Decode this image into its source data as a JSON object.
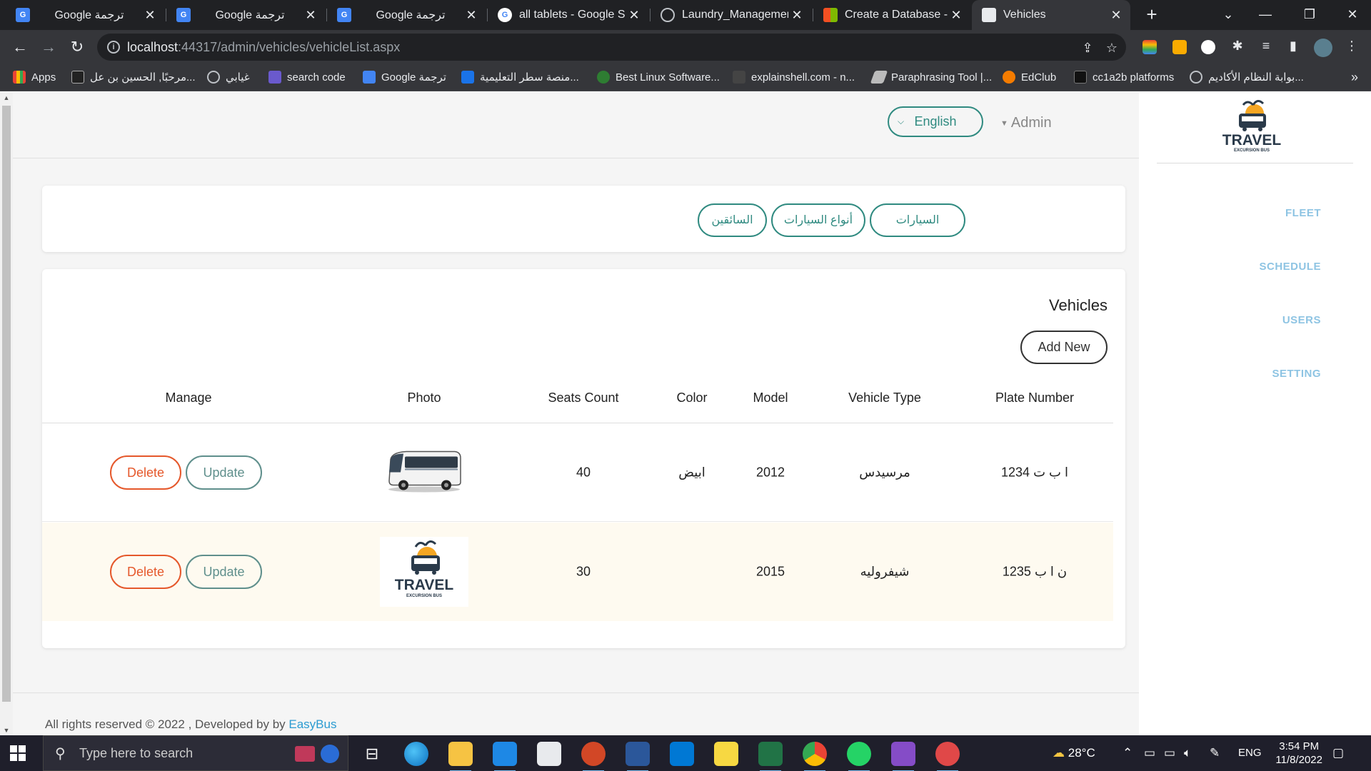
{
  "browser": {
    "tabs": [
      {
        "title": "Google ترجمة",
        "icon": "google-translate-icon",
        "active": false
      },
      {
        "title": "Google ترجمة",
        "icon": "google-translate-icon",
        "active": false
      },
      {
        "title": "Google ترجمة",
        "icon": "google-translate-icon",
        "active": false
      },
      {
        "title": "all tablets - Google Se",
        "icon": "google-icon",
        "active": false
      },
      {
        "title": "Laundry_Managemen",
        "icon": "globe-icon",
        "active": false
      },
      {
        "title": "Create a Database - S",
        "icon": "microsoft-icon",
        "active": false
      },
      {
        "title": "Vehicles",
        "icon": "page-icon",
        "active": true
      }
    ],
    "url_host": "localhost",
    "url_rest": ":44317/admin/vehicles/vehicleList.aspx",
    "bookmarks": [
      {
        "label": "Apps",
        "icon": "apps-grid-icon"
      },
      {
        "label": "مرحبًا, الحسين بن عل...",
        "icon": "blackboard-icon"
      },
      {
        "label": "غيابي",
        "icon": "globe-icon"
      },
      {
        "label": "search code",
        "icon": "search-code-icon"
      },
      {
        "label": "Google ترجمة",
        "icon": "google-translate-icon"
      },
      {
        "label": "منصة سطر التعليمية...",
        "icon": "platform-icon"
      },
      {
        "label": "Best Linux Software...",
        "icon": "linux-icon"
      },
      {
        "label": "explainshell.com - n...",
        "icon": "shell-icon"
      },
      {
        "label": "Paraphrasing Tool |...",
        "icon": "feather-icon"
      },
      {
        "label": "EdClub",
        "icon": "edclub-icon"
      },
      {
        "label": "cc1a2b platforms",
        "icon": "platform-icon"
      },
      {
        "label": "بوابة النظام الأكاديم...",
        "icon": "globe-icon"
      }
    ]
  },
  "header": {
    "language_button": "English",
    "user_menu": "Admin"
  },
  "section_tabs": [
    "السيارات",
    "أنواع السيارات",
    "السائقين"
  ],
  "vehicles": {
    "title": "Vehicles",
    "add_new": "Add New",
    "columns": {
      "manage": "Manage",
      "photo": "Photo",
      "seats": "Seats Count",
      "color": "Color",
      "model": "Model",
      "type": "Vehicle Type",
      "plate": "Plate Number"
    },
    "rows": [
      {
        "plate": "ا ب ت 1234",
        "type": "مرسيدس",
        "model": "2012",
        "color": "ابيض",
        "seats": "40",
        "photo": "bus-photo",
        "delete": "Delete",
        "update": "Update"
      },
      {
        "plate": "1235 ن ا ب",
        "type": "شيفروليه",
        "model": "2015",
        "color": "",
        "seats": "30",
        "photo": "travel-logo",
        "delete": "Delete",
        "update": "Update"
      }
    ]
  },
  "logo": {
    "brand": "TRAVEL",
    "tagline": "EXCURSION BUS"
  },
  "sidebar": {
    "items": [
      "FLEET",
      "SCHEDULE",
      "USERS",
      "SETTING"
    ]
  },
  "footer": {
    "text": "All rights reserved © 2022 , Developed by by ",
    "link": "EasyBus"
  },
  "taskbar": {
    "search_placeholder": "Type here to search",
    "weather": "28°C",
    "language": "ENG",
    "time": "3:54 PM",
    "date": "11/8/2022"
  },
  "colors": {
    "accent": "#2f8a80",
    "danger": "#e5582b",
    "sidebar_text": "#8ec4e3",
    "alt_row": "#fefaf0"
  }
}
